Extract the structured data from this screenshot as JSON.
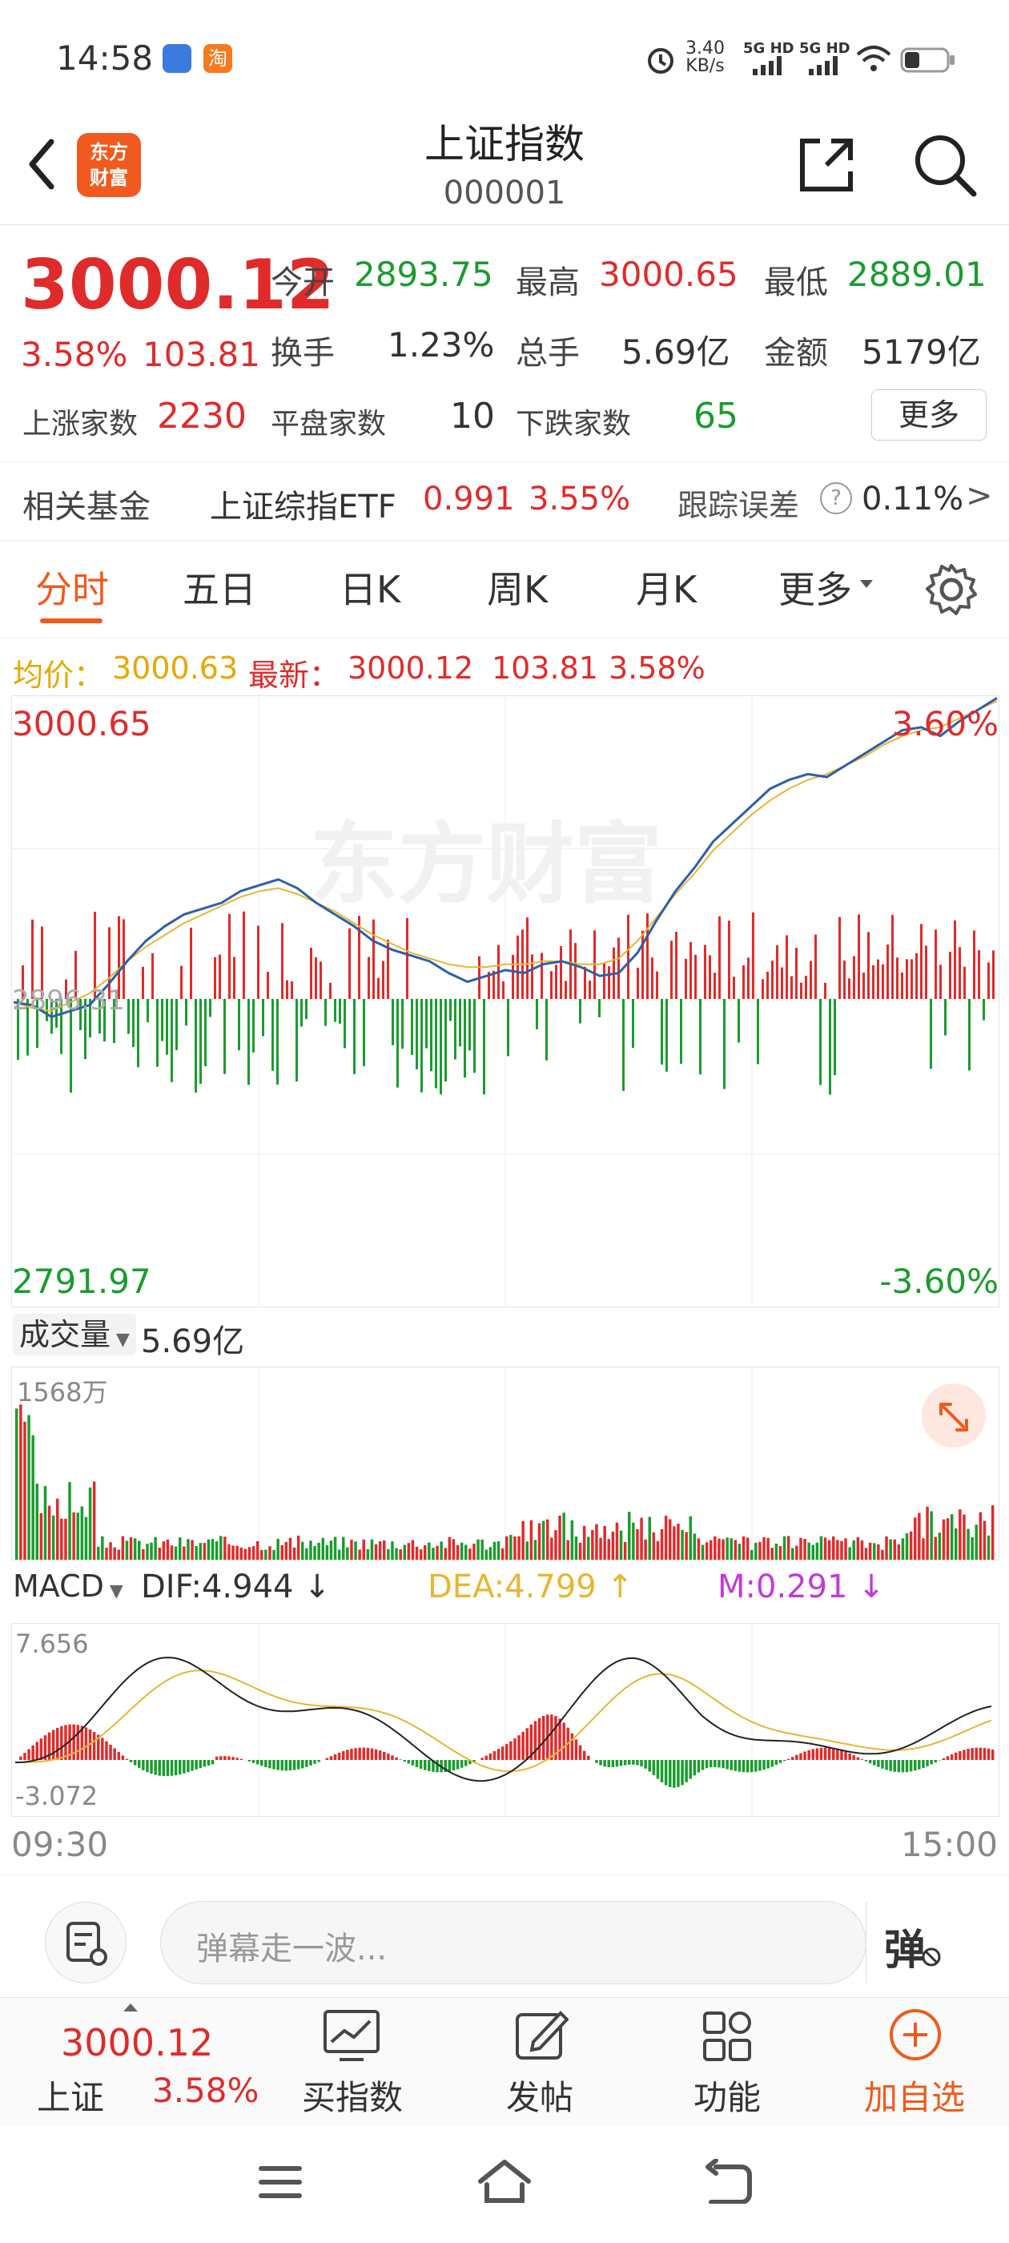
{
  "status": {
    "time": "14:58",
    "net_speed": "3.40",
    "net_unit": "KB/s",
    "sig1": "5G HD",
    "sig2": "5G HD",
    "app_badge": "淘"
  },
  "header": {
    "brand_line1": "东方",
    "brand_line2": "财富",
    "title": "上证指数",
    "code": "000001"
  },
  "quote": {
    "price": "3000.12",
    "change_pct": "3.58%",
    "change_abs": "103.81",
    "open_label": "今开",
    "open": "2893.75",
    "high_label": "最高",
    "high": "3000.65",
    "low_label": "最低",
    "low": "2889.01",
    "turnover_label": "换手",
    "turnover": "1.23%",
    "volume_label": "总手",
    "volume": "5.69亿",
    "amount_label": "金额",
    "amount": "5179亿",
    "up_label": "上涨家数",
    "up": "2230",
    "flat_label": "平盘家数",
    "flat": "10",
    "down_label": "下跌家数",
    "down": "65",
    "more": "更多"
  },
  "fund": {
    "label": "相关基金",
    "name": "上证综指ETF",
    "price": "0.991",
    "pct": "3.55%",
    "track_label": "跟踪误差",
    "track_value": "0.11%"
  },
  "tabs": [
    "分时",
    "五日",
    "日K",
    "周K",
    "月K",
    "更多"
  ],
  "info_line": {
    "avg_label": "均价：",
    "avg": "3000.63",
    "latest_label": "最新：",
    "latest": "3000.12",
    "chg": "103.81",
    "pct": "3.58%"
  },
  "chart": {
    "y_top": "3000.65",
    "y_bottom": "2791.97",
    "pct_top": "3.60%",
    "pct_bottom": "-3.60%",
    "mid_label": "2896.31",
    "watermark": "东方财富"
  },
  "volume_panel": {
    "selector": "成交量",
    "total": "5.69亿",
    "max_label": "1568万"
  },
  "macd_panel": {
    "selector": "MACD",
    "dif": "DIF:4.944",
    "dea": "DEA:4.799",
    "m": "M:0.291",
    "top": "7.656",
    "bottom": "-3.072"
  },
  "time_axis": {
    "start": "09:30",
    "end": "15:00"
  },
  "danmu": {
    "placeholder": "弹幕走一波...",
    "button": "弹"
  },
  "toolbar": {
    "index_price": "3000.12",
    "index_name": "上证",
    "index_pct": "3.58%",
    "buy": "买指数",
    "post": "发帖",
    "func": "功能",
    "add": "加自选"
  },
  "colors": {
    "up": "#e02b2b",
    "down": "#1a9c2e",
    "accent": "#f05a1c",
    "price_line": "#2e5fa8",
    "avg_line": "#e7b632"
  },
  "chart_data": {
    "type": "line",
    "x": [
      "09:30",
      "15:00"
    ],
    "ylim": [
      2791.97,
      3000.65
    ],
    "series": [
      {
        "values": [
          2896,
          2895,
          2891,
          2893,
          2895,
          2902,
          2910,
          2917,
          2922,
          2926,
          2928,
          2930,
          2934,
          2936,
          2938,
          2935,
          2930,
          2926,
          2922,
          2917,
          2914,
          2912,
          2910,
          2906,
          2903,
          2905,
          2907,
          2906,
          2909,
          2910,
          2908,
          2905,
          2906,
          2913,
          2924,
          2934,
          2942,
          2951,
          2957,
          2963,
          2969,
          2972,
          2974,
          2973,
          2977,
          2981,
          2985,
          2989,
          2990,
          2987,
          2992,
          2996,
          3000
        ]
      },
      {
        "values": [
          2896,
          2894,
          2893,
          2896,
          2899,
          2904,
          2910,
          2915,
          2919,
          2923,
          2926,
          2929,
          2932,
          2934,
          2935,
          2933,
          2930,
          2927,
          2923,
          2919,
          2916,
          2913,
          2911,
          2909,
          2908,
          2908,
          2909,
          2909,
          2910,
          2910,
          2909,
          2909,
          2911,
          2917,
          2925,
          2933,
          2940,
          2948,
          2954,
          2960,
          2965,
          2969,
          2972,
          2974,
          2977,
          2980,
          2984,
          2987,
          2989,
          2990,
          2993,
          2996,
          2999
        ]
      }
    ]
  }
}
